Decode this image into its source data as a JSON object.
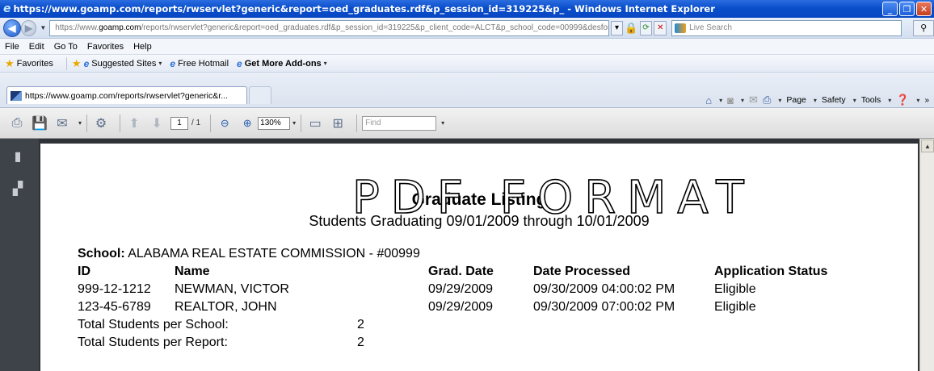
{
  "window": {
    "title": "https://www.goamp.com/reports/rwservlet?generic&report=oed_graduates.rdf&p_session_id=319225&p_ - Windows Internet Explorer"
  },
  "address": {
    "url_prefix": "https://www.",
    "url_domain": "goamp.com",
    "url_rest": "/reports/rwservlet?generic&report=oed_graduates.rdf&p_session_id=319225&p_client_code=ALCT&p_school_code=00999&desform",
    "search_placeholder": "Live Search"
  },
  "menu": [
    "File",
    "Edit",
    "Go To",
    "Favorites",
    "Help"
  ],
  "favorites_bar": {
    "favorites": "Favorites",
    "suggested": "Suggested Sites",
    "hotmail": "Free Hotmail",
    "addons": "Get More Add-ons"
  },
  "tab": {
    "label": "https://www.goamp.com/reports/rwservlet?generic&r..."
  },
  "command_bar": {
    "page": "Page",
    "safety": "Safety",
    "tools": "Tools"
  },
  "pdf_toolbar": {
    "current_page": "1",
    "total_pages": "/ 1",
    "zoom": "130%",
    "find_placeholder": "Find"
  },
  "report": {
    "title": "Graduate Listing",
    "subtitle": "Students Graduating 09/01/2009 through 10/01/2009",
    "school_label": "School:",
    "school_value": "ALABAMA REAL ESTATE COMMISSION - #00999",
    "columns": [
      "ID",
      "Name",
      "Grad. Date",
      "Date Processed",
      "Application Status"
    ],
    "rows": [
      [
        "999-12-1212",
        "NEWMAN, VICTOR",
        "09/29/2009",
        "09/30/2009 04:00:02 PM",
        "Eligible"
      ],
      [
        "123-45-6789",
        "REALTOR, JOHN",
        "09/29/2009",
        "09/30/2009 07:00:02 PM",
        "Eligible"
      ]
    ],
    "total_school_label": "Total Students per School:",
    "total_school_value": "2",
    "total_report_label": "Total Students per Report:",
    "total_report_value": "2"
  },
  "overlay_text": "PDF FORMAT"
}
